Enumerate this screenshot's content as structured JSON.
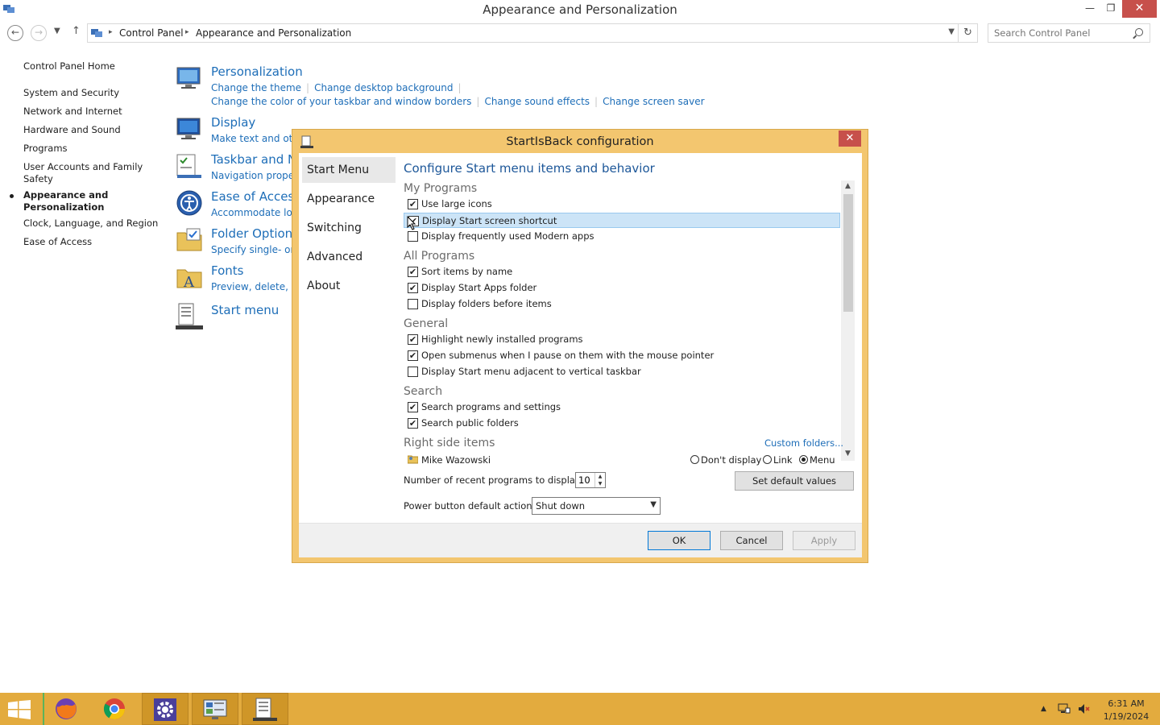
{
  "window": {
    "title": "Appearance and Personalization",
    "minimize": "—",
    "restore": "❐",
    "close": "✕"
  },
  "address": {
    "crumbs": [
      "Control Panel",
      "Appearance and Personalization"
    ],
    "search_placeholder": "Search Control Panel"
  },
  "leftnav": {
    "home": "Control Panel Home",
    "items": [
      "System and Security",
      "Network and Internet",
      "Hardware and Sound",
      "Programs",
      "User Accounts and Family Safety",
      "Appearance and Personalization",
      "Clock, Language, and Region",
      "Ease of Access"
    ]
  },
  "categories": [
    {
      "title": "Personalization",
      "links_line1": [
        "Change the theme",
        "Change desktop background"
      ],
      "links_line2": [
        "Change the color of your taskbar and window borders",
        "Change sound effects",
        "Change screen saver"
      ]
    },
    {
      "title": "Display",
      "links_line1": [
        "Make text and othe"
      ]
    },
    {
      "title": "Taskbar and N",
      "links_line1": [
        "Navigation propert"
      ]
    },
    {
      "title": "Ease of Access",
      "links_line1": [
        "Accommodate low"
      ]
    },
    {
      "title": "Folder Options",
      "links_line1": [
        "Specify single- or d"
      ]
    },
    {
      "title": "Fonts",
      "links_line1": [
        "Preview, delete, or"
      ]
    },
    {
      "title": "Start menu",
      "links_line1": []
    }
  ],
  "dialog": {
    "title": "StartIsBack configuration",
    "close": "✕",
    "tabs": [
      "Start Menu",
      "Appearance",
      "Switching",
      "Advanced",
      "About"
    ],
    "heading": "Configure Start menu items and behavior",
    "groups": {
      "my_programs": "My Programs",
      "all_programs": "All Programs",
      "general": "General",
      "search": "Search",
      "right_side": "Right side items"
    },
    "options": {
      "use_large_icons": {
        "label": "Use large icons",
        "checked": true
      },
      "display_start_screen_shortcut": {
        "label": "Display Start screen shortcut",
        "checked": true
      },
      "display_modern_apps": {
        "label": "Display frequently used Modern apps",
        "checked": false
      },
      "sort_by_name": {
        "label": "Sort items by name",
        "checked": true
      },
      "display_start_apps": {
        "label": "Display Start Apps folder",
        "checked": true
      },
      "folders_before_items": {
        "label": "Display folders before items",
        "checked": false
      },
      "highlight_new": {
        "label": "Highlight newly installed programs",
        "checked": true
      },
      "open_submenus": {
        "label": "Open submenus when I pause on them with the mouse pointer",
        "checked": true
      },
      "adjacent_taskbar": {
        "label": "Display Start menu adjacent to vertical taskbar",
        "checked": false
      },
      "search_programs": {
        "label": "Search programs and settings",
        "checked": true
      },
      "search_public": {
        "label": "Search public folders",
        "checked": true
      }
    },
    "custom_folders": "Custom folders...",
    "right_item": {
      "name": "Mike Wazowski",
      "radio_dont": "Don't display",
      "radio_link": "Link",
      "radio_menu": "Menu",
      "selected": "Menu"
    },
    "recent_label": "Number of recent programs to display:",
    "recent_value": "10",
    "set_default": "Set default values",
    "power_label": "Power button default action:",
    "power_value": "Shut down",
    "ok": "OK",
    "cancel": "Cancel",
    "apply": "Apply"
  },
  "taskbar": {
    "time": "6:31 AM",
    "date": "1/19/2024"
  },
  "colors": {
    "link": "#1e6eb8",
    "heading": "#1d5799",
    "dialog_frame": "#f3c66f",
    "taskbar": "#e3ab3e",
    "close": "#c7504b",
    "selection": "#cce4f7"
  }
}
